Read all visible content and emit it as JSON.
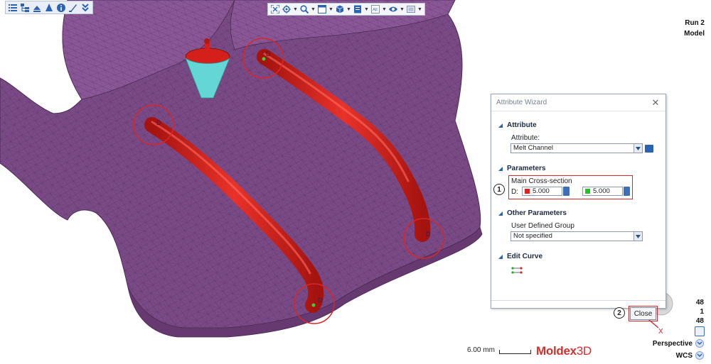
{
  "dialog": {
    "title": "Attribute Wizard",
    "attribute_section": "Attribute",
    "attribute_label": "Attribute:",
    "attribute_value": "Melt Channel",
    "parameters_section": "Parameters",
    "main_cross_section_label": "Main Cross-section",
    "d_label": "D:",
    "d_value_1": "5.000",
    "d_value_2": "5.000",
    "swatch_1_color": "#e02020",
    "swatch_2_color": "#22c422",
    "other_parameters_section": "Other Parameters",
    "user_defined_group_label": "User Defined Group",
    "user_defined_group_value": "Not specified",
    "edit_curve_section": "Edit Curve",
    "close_label": "Close",
    "callout_1": "1",
    "callout_2": "2"
  },
  "top_right": {
    "line1": "Run 2",
    "line2": "Model"
  },
  "stats": {
    "v1": "48",
    "v2": "1",
    "v3": "48"
  },
  "view": {
    "projection": "Perspective",
    "coordinate_system": "WCS"
  },
  "scale": {
    "label": "6.00 mm"
  },
  "brand": {
    "name_part1": "Moldex",
    "name_part2": "3D"
  },
  "model_labels": {
    "d_tag": "D",
    "axis_x": "X"
  },
  "toolbar_left_icons": [
    "list-icon",
    "tree-icon",
    "layers-icon",
    "cone-icon",
    "info-icon",
    "brush-icon",
    "double-chevron-icon"
  ],
  "toolbar_center_icons": [
    "fit-view-icon",
    "select-icon",
    "zoom-icon",
    "window-icon",
    "cube-icon",
    "document-icon",
    "all-icon",
    "eye-icon",
    "display-icon"
  ],
  "colors": {
    "mesh": "#7a4a86",
    "channel": "#d41f1a",
    "sprue": "#5fd3d3",
    "callout_ring": "#d8262b"
  }
}
